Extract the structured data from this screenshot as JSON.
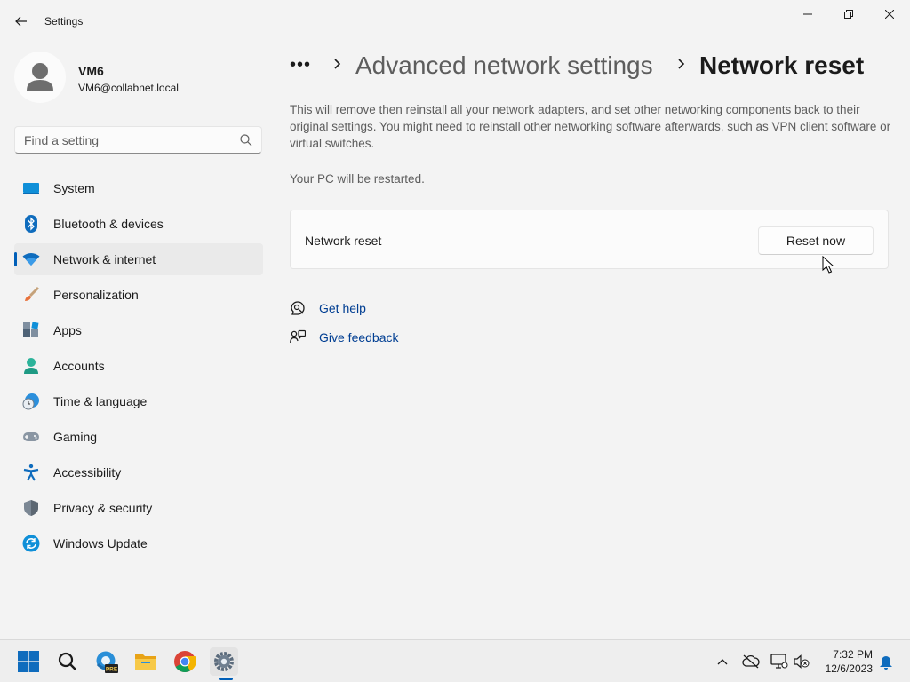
{
  "window": {
    "title": "Settings"
  },
  "profile": {
    "name": "VM6",
    "email": "VM6@collabnet.local"
  },
  "search": {
    "placeholder": "Find a setting"
  },
  "sidebar": {
    "items": [
      {
        "label": "System",
        "icon": "system-icon"
      },
      {
        "label": "Bluetooth & devices",
        "icon": "bluetooth-icon"
      },
      {
        "label": "Network & internet",
        "icon": "wifi-icon",
        "active": true
      },
      {
        "label": "Personalization",
        "icon": "brush-icon"
      },
      {
        "label": "Apps",
        "icon": "apps-icon"
      },
      {
        "label": "Accounts",
        "icon": "accounts-icon"
      },
      {
        "label": "Time & language",
        "icon": "time-language-icon"
      },
      {
        "label": "Gaming",
        "icon": "gamepad-icon"
      },
      {
        "label": "Accessibility",
        "icon": "accessibility-icon"
      },
      {
        "label": "Privacy & security",
        "icon": "shield-icon"
      },
      {
        "label": "Windows Update",
        "icon": "windows-update-icon"
      }
    ]
  },
  "breadcrumb": {
    "more": "•••",
    "parent": "Advanced network settings",
    "current": "Network reset"
  },
  "main": {
    "description": "This will remove then reinstall all your network adapters, and set other networking components back to their original settings. You might need to reinstall other networking software afterwards, such as VPN client software or virtual switches.",
    "restart_note": "Your PC will be restarted.",
    "card": {
      "label": "Network reset",
      "button_label": "Reset now"
    },
    "links": [
      {
        "label": "Get help",
        "icon": "help-icon"
      },
      {
        "label": "Give feedback",
        "icon": "feedback-icon"
      }
    ]
  },
  "taskbar": {
    "apps": [
      "start-icon",
      "search-icon",
      "edge-beta-icon",
      "file-explorer-icon",
      "chrome-icon",
      "settings-icon"
    ],
    "edge_badge": "PRE",
    "clock": {
      "time": "7:32 PM",
      "date": "12/6/2023"
    }
  },
  "colors": {
    "accent": "#005fb8",
    "link": "#003e92",
    "background": "#f3f3f3"
  }
}
